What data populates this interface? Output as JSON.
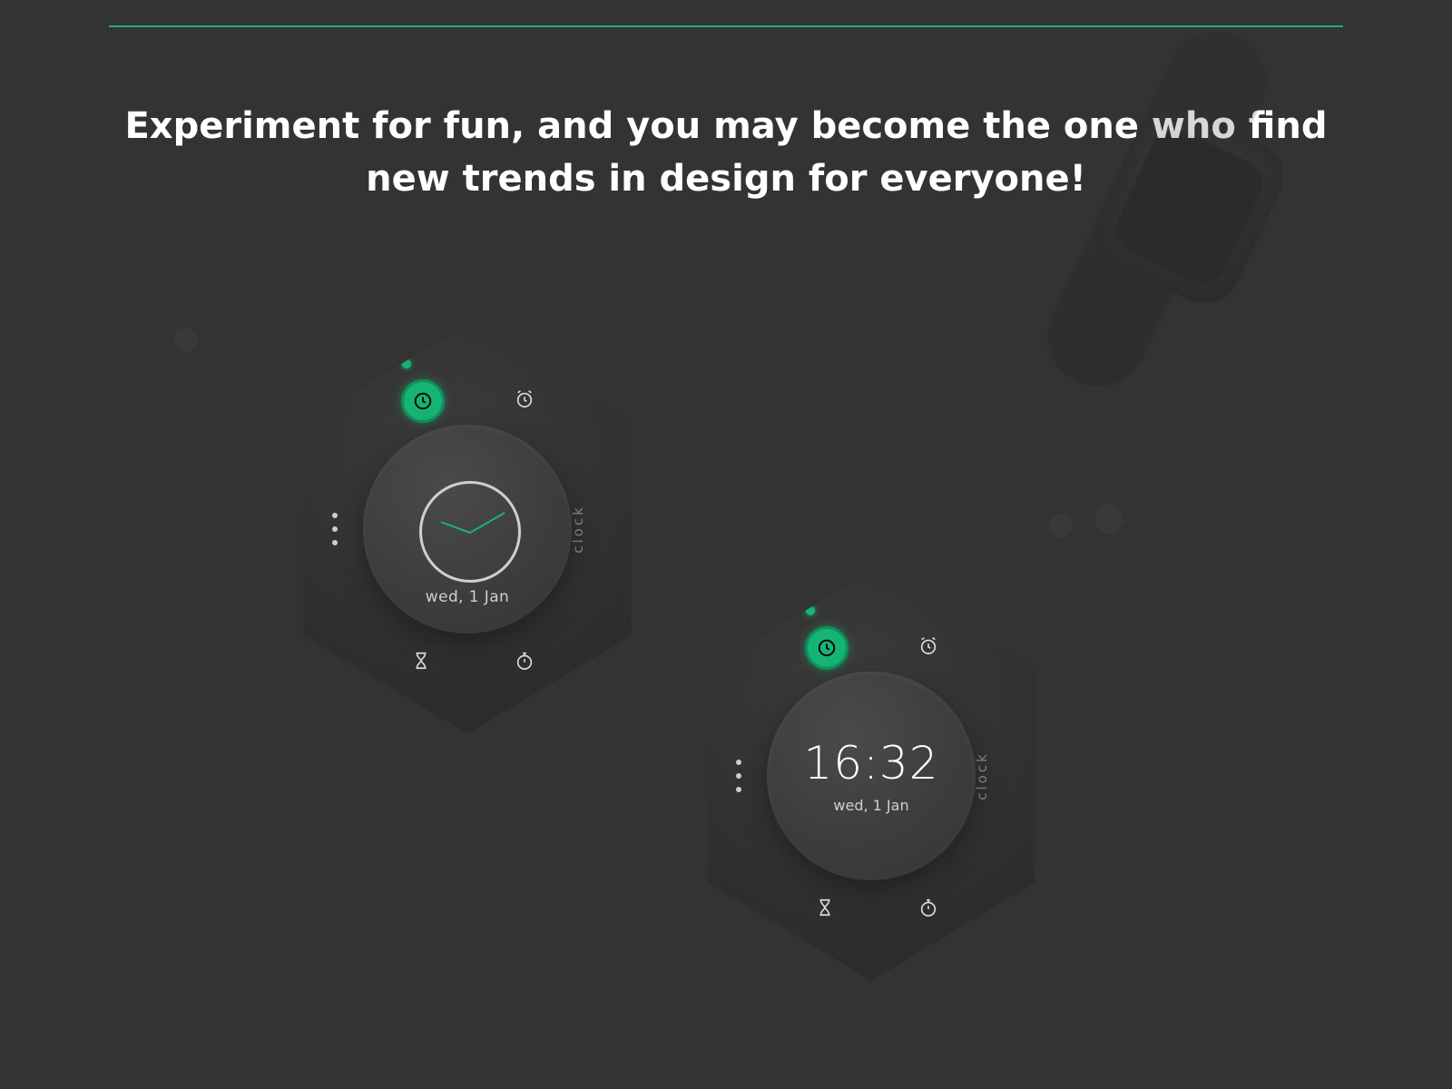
{
  "accent_color": "#16B474",
  "headline_line1": "Experiment for fun, and you may become the one who find",
  "headline_line2": "new trends in design for everyone!",
  "widget_a": {
    "mode_label": "clock",
    "date": "wed, 1 Jan",
    "icons": {
      "clock": "clock-icon",
      "alarm": "alarm-icon",
      "hourglass": "hourglass-icon",
      "stopwatch": "stopwatch-icon",
      "more": "more-icon"
    }
  },
  "widget_b": {
    "mode_label": "clock",
    "time": "16:32",
    "date": "wed, 1 Jan",
    "icons": {
      "clock": "clock-icon",
      "alarm": "alarm-icon",
      "hourglass": "hourglass-icon",
      "stopwatch": "stopwatch-icon",
      "more": "more-icon"
    }
  }
}
